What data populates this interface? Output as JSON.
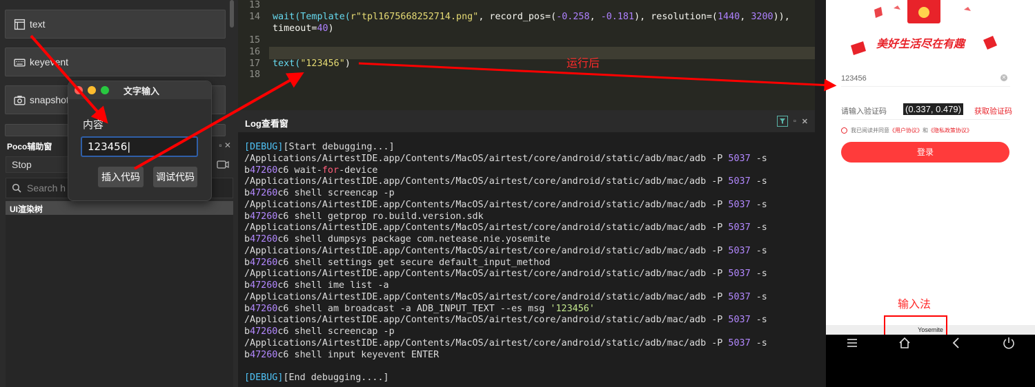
{
  "left_panel": {
    "actions": [
      {
        "label": "text",
        "icon": "text-icon"
      },
      {
        "label": "keyevent",
        "icon": "keyboard-icon"
      },
      {
        "label": "snapshot",
        "icon": "camera-icon"
      }
    ],
    "poco_title": "Poco辅助窗",
    "poco_mode": "Stop",
    "search_placeholder": "Search h",
    "tree_header": "UI渲染树"
  },
  "dialog": {
    "title": "文字输入",
    "label": "内容",
    "input_value": "123456",
    "insert_button": "插入代码",
    "debug_button": "调试代码"
  },
  "editor": {
    "line_numbers": [
      "13",
      "14",
      "",
      "15",
      "16",
      "17",
      "18"
    ],
    "code": {
      "l14_a": "wait(Template(",
      "l14_str": "r\"tpl1675668252714.png\"",
      "l14_b": ", record_pos=(",
      "l14_n1": "-0.258",
      "l14_c": ", ",
      "l14_n2": "-0.181",
      "l14_d": "), resolution=(",
      "l14_n3": "1440",
      "l14_e": ", ",
      "l14_n4": "3200",
      "l14_f": ")),",
      "l14_g": "timeout=",
      "l14_n5": "40",
      "l14_h": ")",
      "l17_fn": "text(",
      "l17_str": "\"123456\"",
      "l17_end": ")"
    },
    "note_run": "运行后"
  },
  "log": {
    "title": "Log查看窗",
    "start": "[DEBUG]",
    "start_text": "[Start debugging...]",
    "adb_path": "/Applications/AirtestIDE.app/Contents/MacOS/airtest/core/android/static/adb/mac/adb -P ",
    "port": "5037",
    "flag": " -s",
    "serial_a": "b",
    "serial_b": "47260",
    "serial_c": "c6",
    "commands": [
      " wait-for-device",
      " shell screencap -p",
      " shell getprop ro.build.version.sdk",
      " shell dumpsys package com.netease.nie.yosemite",
      " shell settings get secure default_input_method",
      " shell ime list -a",
      " shell am broadcast -a ADB_INPUT_TEXT --es msg '123456'",
      " shell screencap -p",
      " shell input keyevent ENTER"
    ],
    "end": "[DEBUG]",
    "end_text": "[End debugging....]"
  },
  "phone": {
    "slogan": "美好生活尽在有趣",
    "phone_value": "123456",
    "code_placeholder": "请输入验证码",
    "coord_tip": "(0.337, 0.479)",
    "code_button": "获取验证码",
    "agree_prefix": "我已阅读并同意",
    "user_agreement": "《用户协议》",
    "and": "和",
    "privacy": "《隐私政策协议》",
    "login": "登录",
    "note_ime": "输入法",
    "ime_name": "Yosemite"
  },
  "colors": {
    "accent_red": "#ff0000",
    "editor_bg": "#272822",
    "log_bg": "#1e1e1e"
  }
}
